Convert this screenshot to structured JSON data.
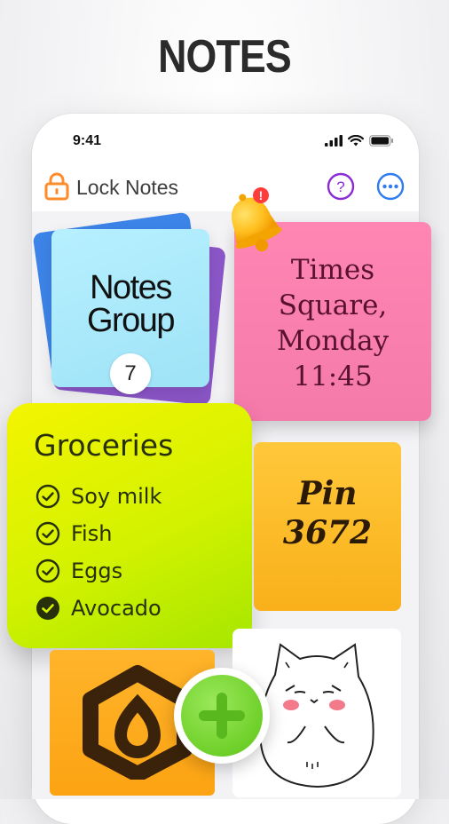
{
  "promo": {
    "headline": "NOTES"
  },
  "status_bar": {
    "time": "9:41"
  },
  "header": {
    "title": "Lock Notes",
    "help_symbol": "?",
    "icons": [
      "lock-icon",
      "help-icon",
      "more-icon"
    ],
    "accent": "#ff8a2a",
    "action_color": "#8b2bd6",
    "more_color": "#2f7bf0"
  },
  "notes": {
    "group": {
      "title_line1": "Notes",
      "title_line2": "Group",
      "count": "7"
    },
    "pink": {
      "line1": "Times",
      "line2": "Square,",
      "line3": "Monday",
      "line4": "11:45"
    },
    "groceries": {
      "title": "Groceries",
      "items": [
        {
          "label": "Soy milk",
          "checked": false
        },
        {
          "label": "Fish",
          "checked": false
        },
        {
          "label": "Eggs",
          "checked": false
        },
        {
          "label": "Avocado",
          "checked": true
        }
      ]
    },
    "pin": {
      "line1": "Pin",
      "line2": "3672"
    },
    "orange": {
      "icon": "app-logo-icon"
    },
    "cat": {
      "icon": "cat-sketch"
    }
  },
  "fab": {
    "icon": "plus-icon",
    "color": "#6fd02a"
  },
  "reminder": {
    "icon": "bell-icon",
    "badge": "!"
  }
}
